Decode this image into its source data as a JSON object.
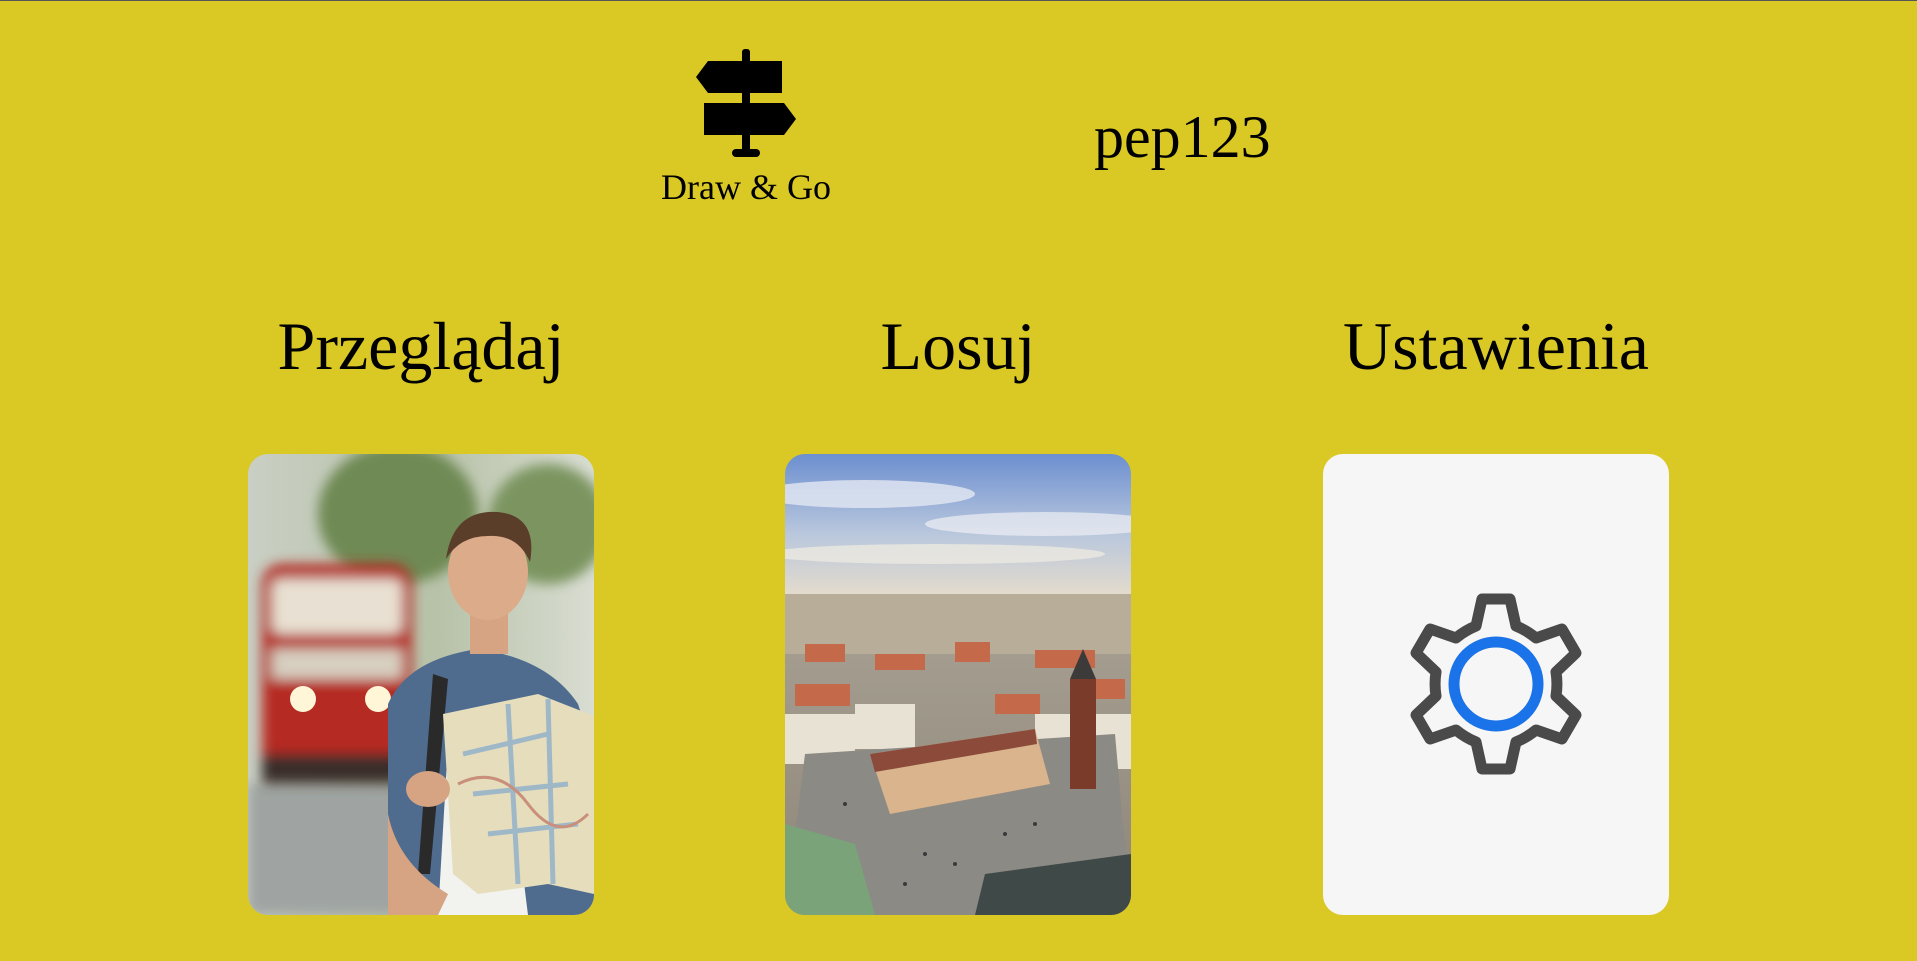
{
  "header": {
    "logo_text": "Draw & Go",
    "username": "pep123"
  },
  "nav": {
    "browse": {
      "label": "Przeglądaj",
      "image": "tourist-with-map-photo"
    },
    "random": {
      "label": "Losuj",
      "image": "krakow-old-town-aerial-photo"
    },
    "settings": {
      "label": "Ustawienia",
      "icon": "gear-icon"
    }
  },
  "colors": {
    "background": "#dac824",
    "settings_card": "#f6f6f6",
    "gear_stroke": "#4a4a4a",
    "gear_center": "#1a73e8"
  }
}
